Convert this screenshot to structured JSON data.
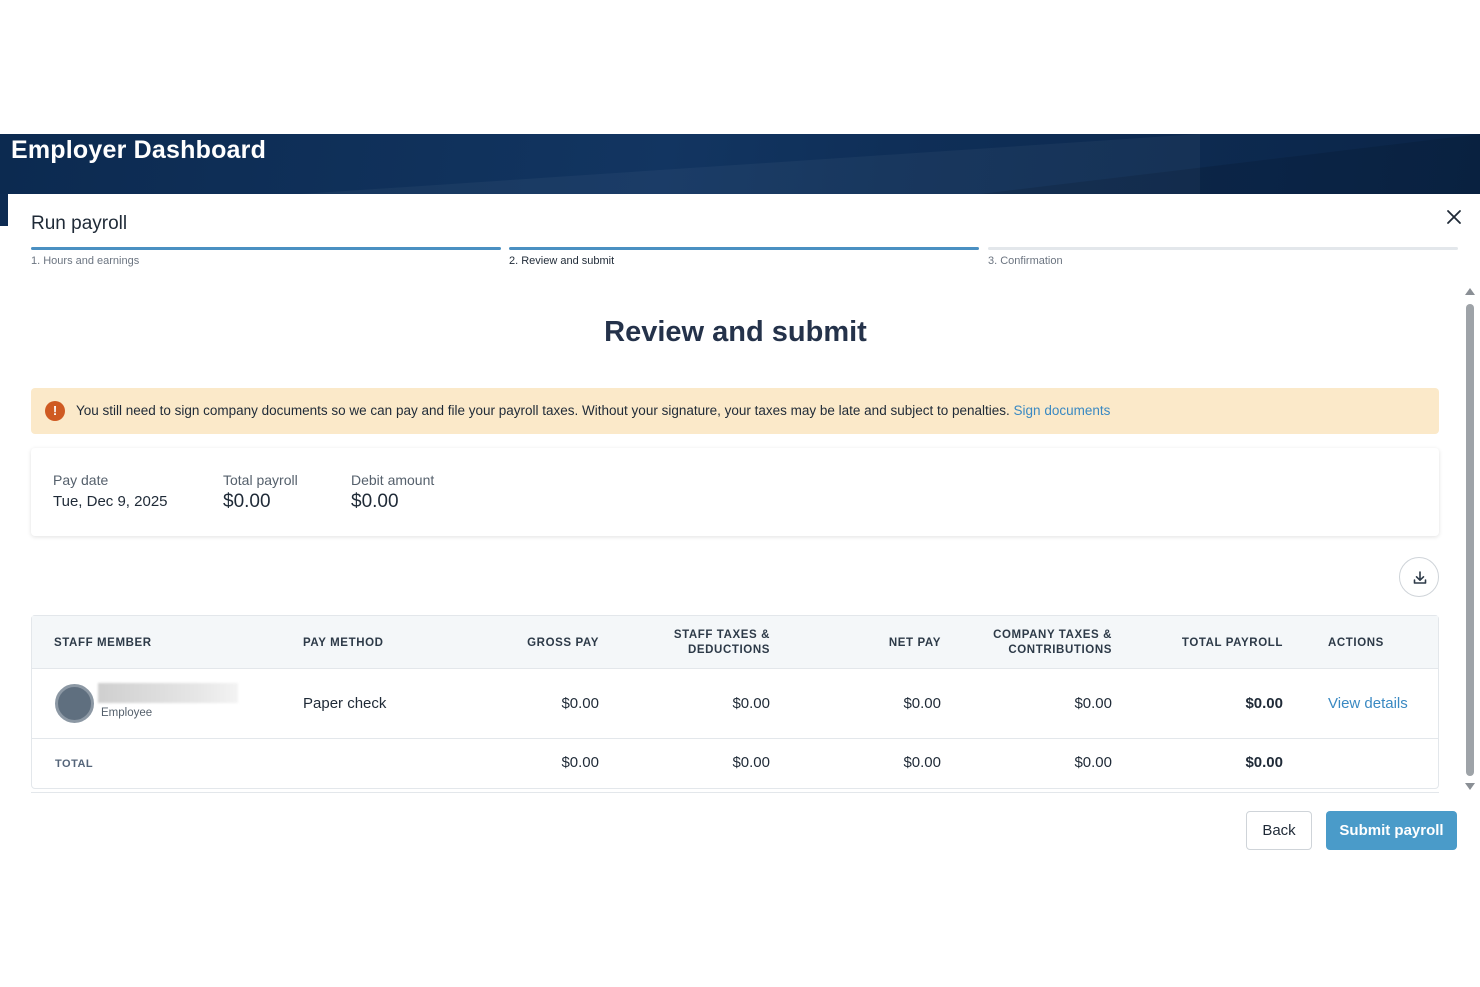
{
  "header": {
    "title": "Employer Dashboard"
  },
  "modal": {
    "title": "Run payroll",
    "close_icon": "close-icon",
    "steps": [
      {
        "label": "1. Hours and earnings",
        "state": "done"
      },
      {
        "label": "2. Review and submit",
        "state": "active"
      },
      {
        "label": "3. Confirmation",
        "state": "pending"
      }
    ],
    "heading": "Review and submit"
  },
  "alert": {
    "icon": "exclamation-icon",
    "text": "You still need to sign company documents so we can pay and file your payroll taxes. Without your signature, your taxes may be late and subject to penalties.",
    "link_label": "Sign documents"
  },
  "summary": {
    "pay_date_label": "Pay date",
    "pay_date": "Tue, Dec 9, 2025",
    "total_payroll_label": "Total payroll",
    "total_payroll": "$0.00",
    "debit_amount_label": "Debit amount",
    "debit_amount": "$0.00"
  },
  "download_icon": "download-icon",
  "table": {
    "columns": {
      "staff_member": "STAFF MEMBER",
      "pay_method": "PAY METHOD",
      "gross_pay": "GROSS PAY",
      "staff_taxes_1": "STAFF TAXES &",
      "staff_taxes_2": "DEDUCTIONS",
      "net_pay": "NET PAY",
      "company_taxes_1": "COMPANY TAXES &",
      "company_taxes_2": "CONTRIBUTIONS",
      "total_payroll": "TOTAL PAYROLL",
      "actions": "ACTIONS"
    },
    "row": {
      "role": "Employee",
      "pay_method": "Paper check",
      "gross_pay": "$0.00",
      "staff_taxes": "$0.00",
      "net_pay": "$0.00",
      "company_taxes": "$0.00",
      "total_payroll": "$0.00",
      "action_label": "View details"
    },
    "totals": {
      "label": "TOTAL",
      "gross_pay": "$0.00",
      "staff_taxes": "$0.00",
      "net_pay": "$0.00",
      "company_taxes": "$0.00",
      "total_payroll": "$0.00"
    }
  },
  "footer": {
    "back_label": "Back",
    "submit_label": "Submit payroll"
  },
  "colors": {
    "header_navy": "#0f2f58",
    "accent_blue": "#4a90c2",
    "link_blue": "#3a89c2",
    "alert_bg": "#fbe9c9",
    "alert_icon": "#cf5a22"
  }
}
